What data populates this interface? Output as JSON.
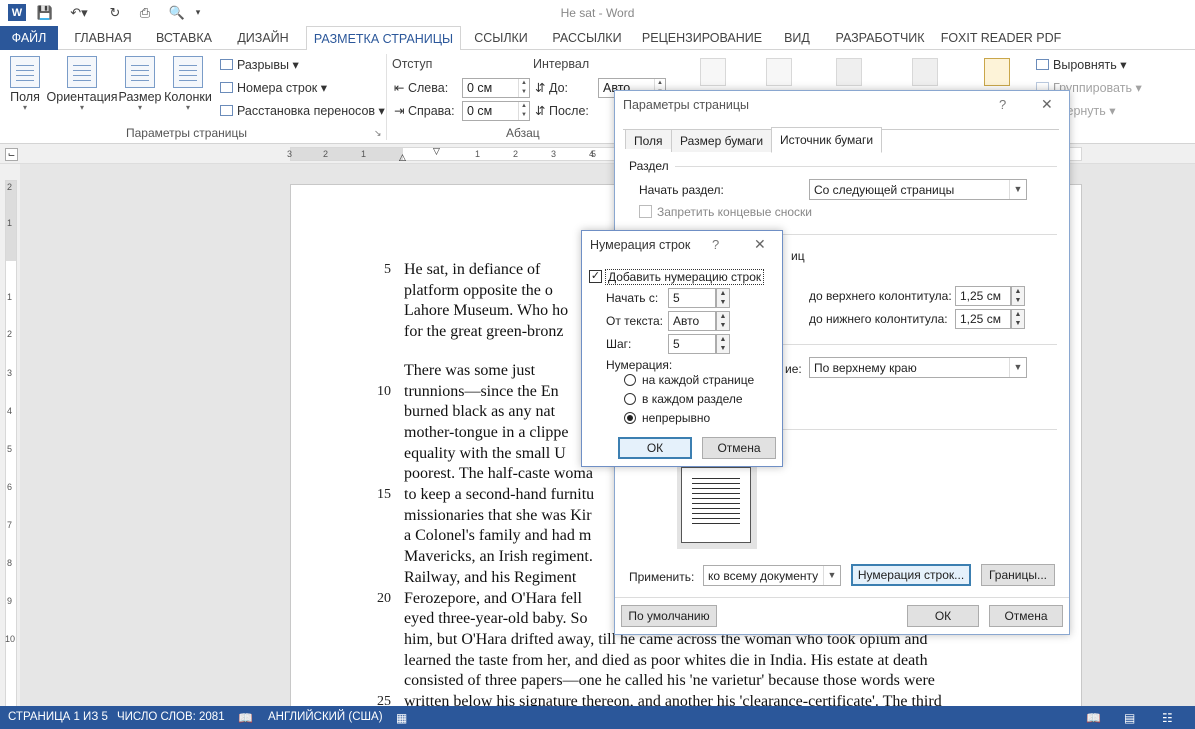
{
  "window": {
    "title": "He sat - Word"
  },
  "tabs": [
    "ФАЙЛ",
    "ГЛАВНАЯ",
    "ВСТАВКА",
    "ДИЗАЙН",
    "РАЗМЕТКА СТРАНИЦЫ",
    "ССЫЛКИ",
    "РАССЫЛКИ",
    "РЕЦЕНЗИРОВАНИЕ",
    "ВИД",
    "РАЗРАБОТЧИК",
    "FOXIT READER PDF"
  ],
  "ribbon": {
    "big_buttons": [
      "Поля",
      "Ориентация",
      "Размер",
      "Колонки"
    ],
    "breaks": "Разрывы",
    "line_numbers": "Номера строк",
    "hyphenation": "Расстановка переносов",
    "group_page_setup": "Параметры страницы",
    "indent": "Отступ",
    "indent_left_label": "Слева:",
    "indent_left_value": "0 см",
    "indent_right_label": "Справа:",
    "indent_right_value": "0 см",
    "spacing": "Интервал",
    "spacing_before_label": "До:",
    "spacing_before_value": "Авто",
    "spacing_after_label": "После:",
    "group_paragraph": "Абзац",
    "align": "Выровнять",
    "group": "Группировать",
    "rotate": "вернуть"
  },
  "ruler": {
    "numbers": [
      "3",
      "2",
      "1",
      "1",
      "2",
      "3",
      "4",
      "5"
    ]
  },
  "vruler": {
    "numbers": [
      "2",
      "1",
      "1",
      "2",
      "3",
      "4",
      "5",
      "6",
      "7",
      "8",
      "9",
      "10"
    ]
  },
  "document": {
    "lines": [
      {
        "num": "5",
        "text": "      He sat, in defiance of"
      },
      {
        "num": "",
        "text": "platform opposite the o"
      },
      {
        "num": "",
        "text": "Lahore Museum. Who ho"
      },
      {
        "num": "",
        "text": "for the great green-bronz"
      },
      {
        "num": "",
        "text": "      There was some just"
      },
      {
        "num": "10",
        "text": "trunnions—since the En"
      },
      {
        "num": "",
        "text": "burned black as any nat"
      },
      {
        "num": "",
        "text": "mother-tongue in a clippe"
      },
      {
        "num": "",
        "text": "equality with the small U"
      },
      {
        "num": "",
        "text": "poorest. The half-caste woma"
      },
      {
        "num": "15",
        "text": "to keep a second-hand furnitu"
      },
      {
        "num": "",
        "text": "missionaries that she was Kir"
      },
      {
        "num": "",
        "text": "a Colonel's family and had m"
      },
      {
        "num": "",
        "text": "Mavericks, an Irish regiment."
      },
      {
        "num": "",
        "text": "Railway, and his Regiment"
      },
      {
        "num": "20",
        "text": "Ferozepore, and O'Hara fell"
      },
      {
        "num": "",
        "text": "eyed three-year-old baby. So"
      },
      {
        "num": "",
        "text": "him, but O'Hara drifted away, till he came across the woman who took opium and"
      },
      {
        "num": "",
        "text": "learned the taste from her, and died as poor whites die in India. His estate at death"
      },
      {
        "num": "",
        "text": "consisted of three papers—one he called his 'ne varietur' because those words were"
      },
      {
        "num": "25",
        "text": "written below his signature thereon, and another his 'clearance-certificate'. The third"
      }
    ]
  },
  "status": {
    "page": "СТРАНИЦА 1 ИЗ 5",
    "words": "ЧИСЛО СЛОВ: 2081",
    "language": "АНГЛИЙСКИЙ (США)"
  },
  "page_setup": {
    "title": "Параметры страницы",
    "help": "?",
    "tabs": [
      "Поля",
      "Размер бумаги",
      "Источник бумаги"
    ],
    "section_label": "Раздел",
    "start_section_label": "Начать раздел:",
    "start_section_value": "Со следующей страницы",
    "suppress_endnotes": "Запретить концевые сноски",
    "headers_partial": "иц",
    "from_header_label": "до верхнего колонтитула:",
    "from_header_value": "1,25 см",
    "from_footer_label": "до нижнего колонтитула:",
    "from_footer_value": "1,25 см",
    "valign_partial": "ие:",
    "valign_value": "По верхнему краю",
    "apply_label": "Применить:",
    "apply_value": "ко всему документу",
    "line_numbers_btn": "Нумерация строк...",
    "borders_btn": "Границы...",
    "default_btn": "По умолчанию",
    "ok": "ОК",
    "cancel": "Отмена"
  },
  "line_numbering": {
    "title": "Нумерация строк",
    "help": "?",
    "add_checkbox": "Добавить нумерацию строк",
    "start_label": "Начать с:",
    "start_value": "5",
    "from_text_label": "От текста:",
    "from_text_value": "Авто",
    "step_label": "Шаг:",
    "step_value": "5",
    "numbering_label": "Нумерация:",
    "options": [
      "на каждой странице",
      "в каждом разделе",
      "непрерывно"
    ],
    "ok": "ОК",
    "cancel": "Отмена"
  }
}
